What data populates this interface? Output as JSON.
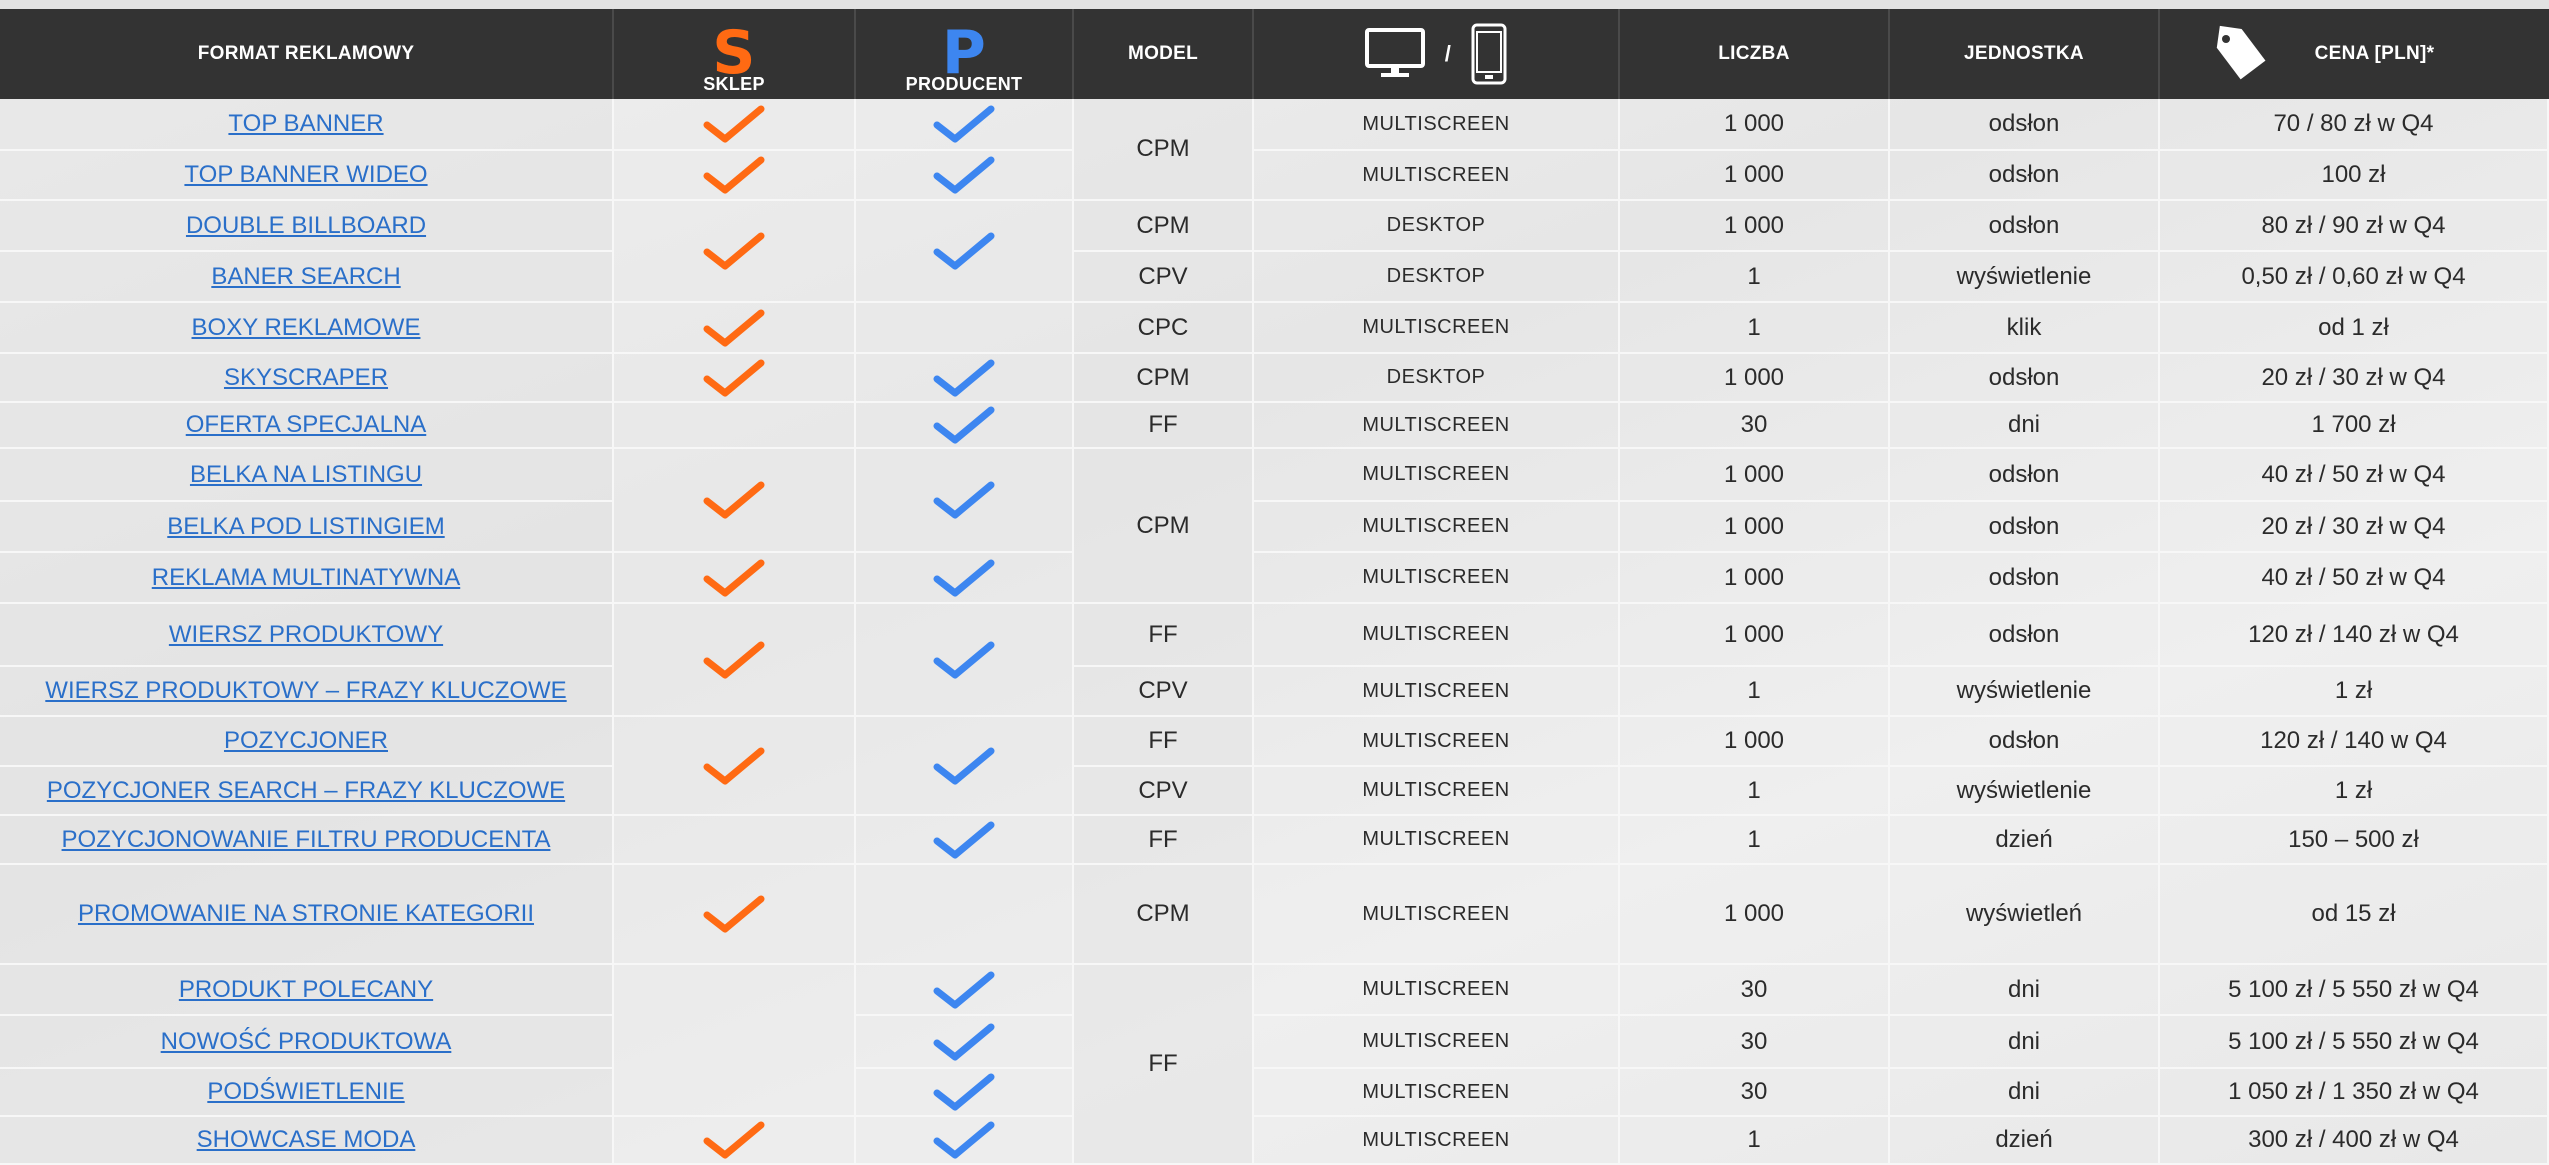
{
  "header": {
    "format": "FORMAT REKLAMOWY",
    "sklep_letter": "S",
    "sklep": "SKLEP",
    "producent_letter": "P",
    "producent": "PRODUCENT",
    "model": "MODEL",
    "device_separator": "/",
    "liczba": "LICZBA",
    "jednostka": "JEDNOSTKA",
    "cena": "CENA [PLN]*"
  },
  "colors": {
    "sklep": "#ff6a13",
    "producent": "#3d86f0",
    "link": "#2a6fc9",
    "header_bg": "#333333"
  },
  "icons": {
    "desktop": "monitor-icon",
    "mobile": "smartphone-icon",
    "price": "price-tag-icon",
    "check": "checkmark-icon"
  },
  "rows": [
    {
      "format": "TOP BANNER",
      "device": "MULTISCREEN",
      "liczba": "1 000",
      "jednostka": "odsłon",
      "cena": "70 / 80 zł w Q4"
    },
    {
      "format": "TOP BANNER WIDEO",
      "device": "MULTISCREEN",
      "liczba": "1 000",
      "jednostka": "odsłon",
      "cena": "100 zł"
    },
    {
      "format": "DOUBLE BILLBOARD",
      "device": "DESKTOP",
      "liczba": "1 000",
      "jednostka": "odsłon",
      "cena": "80 zł / 90 zł w Q4"
    },
    {
      "format": "BANER SEARCH",
      "device": "DESKTOP",
      "liczba": "1",
      "jednostka": "wyświetlenie",
      "cena": "0,50 zł / 0,60 zł w Q4"
    },
    {
      "format": "BOXY REKLAMOWE",
      "device": "MULTISCREEN",
      "liczba": "1",
      "jednostka": "klik",
      "cena": "od 1 zł"
    },
    {
      "format": "SKYSCRAPER",
      "device": "DESKTOP",
      "liczba": "1 000",
      "jednostka": "odsłon",
      "cena": "20 zł / 30 zł w Q4"
    },
    {
      "format": "OFERTA SPECJALNA",
      "device": "MULTISCREEN",
      "liczba": "30",
      "jednostka": "dni",
      "cena": "1 700 zł"
    },
    {
      "format": "BELKA NA LISTINGU",
      "device": "MULTISCREEN",
      "liczba": "1 000",
      "jednostka": "odsłon",
      "cena": "40 zł / 50 zł w Q4"
    },
    {
      "format": "BELKA POD LISTINGIEM",
      "device": "MULTISCREEN",
      "liczba": "1 000",
      "jednostka": "odsłon",
      "cena": "20 zł / 30 zł w Q4"
    },
    {
      "format": "REKLAMA MULTINATYWNA",
      "device": "MULTISCREEN",
      "liczba": "1 000",
      "jednostka": "odsłon",
      "cena": "40 zł / 50 zł w Q4"
    },
    {
      "format": "WIERSZ PRODUKTOWY",
      "device": "MULTISCREEN",
      "liczba": "1 000",
      "jednostka": "odsłon",
      "cena": "120 zł / 140 zł w Q4"
    },
    {
      "format": "WIERSZ PRODUKTOWY – FRAZY KLUCZOWE",
      "device": "MULTISCREEN",
      "liczba": "1",
      "jednostka": "wyświetlenie",
      "cena": "1 zł"
    },
    {
      "format": "POZYCJONER",
      "device": "MULTISCREEN",
      "liczba": "1 000",
      "jednostka": "odsłon",
      "cena": "120 zł / 140 w Q4"
    },
    {
      "format": "POZYCJONER SEARCH – FRAZY KLUCZOWE",
      "device": "MULTISCREEN",
      "liczba": "1",
      "jednostka": "wyświetlenie",
      "cena": "1 zł"
    },
    {
      "format": "POZYCJONOWANIE FILTRU PRODUCENTA",
      "device": "MULTISCREEN",
      "liczba": "1",
      "jednostka": "dzień",
      "cena": "150 – 500 zł"
    },
    {
      "format": "PROMOWANIE NA STRONIE KATEGORII",
      "device": "MULTISCREEN",
      "liczba": "1 000",
      "jednostka": "wyświetleń",
      "cena": "od 15 zł"
    },
    {
      "format": "PRODUKT POLECANY",
      "device": "MULTISCREEN",
      "liczba": "30",
      "jednostka": "dni",
      "cena": "5 100 zł / 5 550 zł w Q4"
    },
    {
      "format": "NOWOŚĆ PRODUKTOWA",
      "device": "MULTISCREEN",
      "liczba": "30",
      "jednostka": "dni",
      "cena": "5 100 zł / 5 550 zł w Q4"
    },
    {
      "format": "PODŚWIETLENIE",
      "device": "MULTISCREEN",
      "liczba": "30",
      "jednostka": "dni",
      "cena": "1 050 zł / 1 350 zł w Q4"
    },
    {
      "format": "SHOWCASE MODA",
      "device": "MULTISCREEN",
      "liczba": "1",
      "jednostka": "dzień",
      "cena": "300 zł / 400 zł w Q4"
    }
  ],
  "model_groups": [
    {
      "label": "CPM"
    },
    {
      "label": "CPM"
    },
    {
      "label": "CPV"
    },
    {
      "label": "CPC"
    },
    {
      "label": "CPM"
    },
    {
      "label": "FF"
    },
    {
      "label": "CPM"
    },
    {
      "label": "FF"
    },
    {
      "label": "CPV"
    },
    {
      "label": "FF"
    },
    {
      "label": "CPV"
    },
    {
      "label": "FF"
    },
    {
      "label": "CPM"
    },
    {
      "label": "FF"
    }
  ],
  "sklep_checks": [
    true,
    true,
    true,
    true,
    true,
    true,
    true,
    true,
    true,
    true,
    true,
    true
  ],
  "producent_checks": [
    true,
    true,
    true,
    true,
    true,
    true,
    true,
    true,
    true,
    true,
    true,
    true,
    true,
    true,
    true
  ]
}
